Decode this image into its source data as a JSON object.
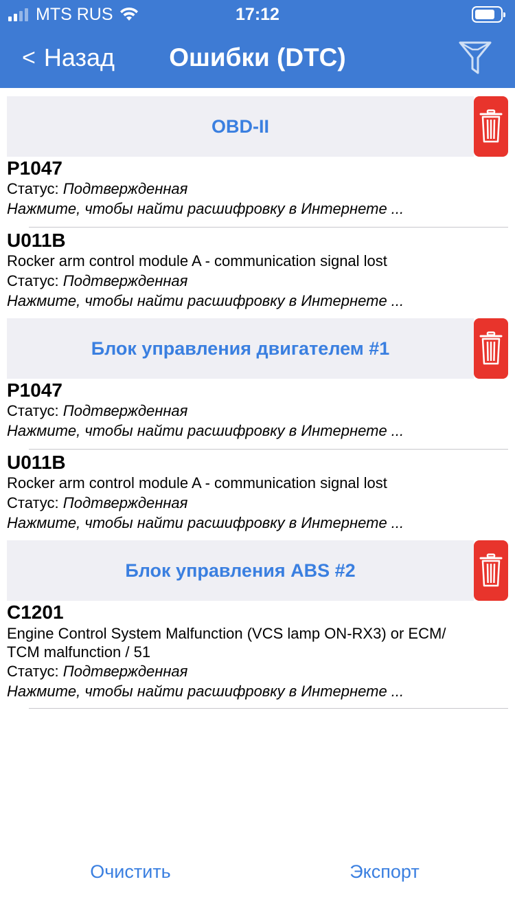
{
  "status_bar": {
    "carrier": "MTS RUS",
    "time": "17:12"
  },
  "nav": {
    "back_label": "Назад",
    "back_chevron": "<",
    "title": "Ошибки (DTC)",
    "filter_icon": "filter-icon"
  },
  "sections": [
    {
      "title": "OBD-II",
      "delete_icon": "trash-icon",
      "items": [
        {
          "code": "P1047",
          "status_label": "Статус:",
          "status_value": "Подтвержденная",
          "hint": "Нажмите, чтобы найти расшифровку в Интернете ..."
        },
        {
          "code": "U011B",
          "description": "Rocker arm control module A - communication signal lost",
          "status_label": "Статус:",
          "status_value": "Подтвержденная",
          "hint": "Нажмите, чтобы найти расшифровку в Интернете ..."
        }
      ]
    },
    {
      "title": "Блок управления двигателем #1",
      "delete_icon": "trash-icon",
      "items": [
        {
          "code": "P1047",
          "status_label": "Статус:",
          "status_value": "Подтвержденная",
          "hint": "Нажмите, чтобы найти расшифровку в Интернете ..."
        },
        {
          "code": "U011B",
          "description": "Rocker arm control module A - communication signal lost",
          "status_label": "Статус:",
          "status_value": "Подтвержденная",
          "hint": "Нажмите, чтобы найти расшифровку в Интернете ..."
        }
      ]
    },
    {
      "title": "Блок управления ABS #2",
      "delete_icon": "trash-icon",
      "items": [
        {
          "code": "C1201",
          "description_line1": "Engine Control System Malfunction (VCS lamp ON-RX3) or ECM/",
          "description_line2": "TCM malfunction / 51",
          "status_label": "Статус:",
          "status_value": "Подтвержденная",
          "hint": "Нажмите, чтобы найти расшифровку в Интернете ..."
        }
      ]
    }
  ],
  "footer": {
    "clear_label": "Очистить",
    "export_label": "Экспорт"
  },
  "colors": {
    "nav_bar": "#3e7bd4",
    "accent": "#3a7fe0",
    "section_bg": "#efeff4",
    "delete": "#e8342c"
  }
}
